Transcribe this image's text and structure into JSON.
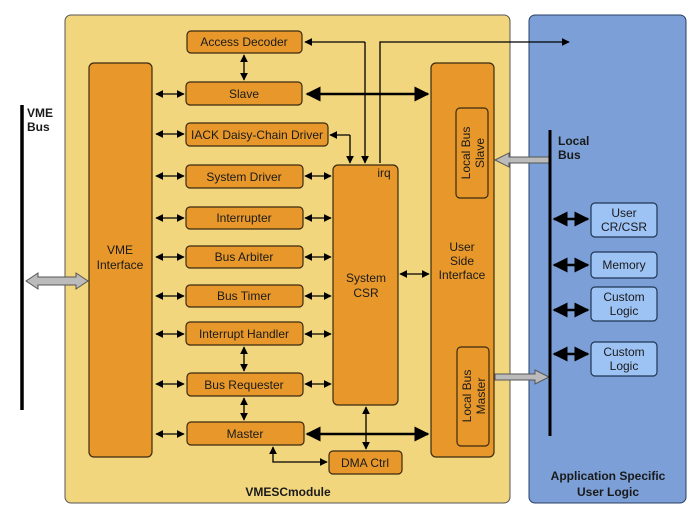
{
  "colors": {
    "module": "#f2d67e",
    "block": "#e8982a",
    "app": "#7b9fd6",
    "user_block": "#9dc3f5"
  },
  "vme_bus": [
    "VME",
    "Bus"
  ],
  "module_label": "VMESCmodule",
  "vme_interface": [
    "VME",
    "Interface"
  ],
  "blocks": {
    "access_decoder": "Access Decoder",
    "slave": "Slave",
    "iack": "IACK Daisy-Chain Driver",
    "system_driver": "System Driver",
    "interrupter": "Interrupter",
    "bus_arbiter": "Bus Arbiter",
    "bus_timer": "Bus Timer",
    "interrupt_handler": "Interrupt Handler",
    "bus_requester": "Bus Requester",
    "master": "Master",
    "dma_ctrl": "DMA Ctrl"
  },
  "system_csr": [
    "System",
    "CSR"
  ],
  "irq": "irq",
  "user_side": [
    "User",
    "Side",
    "Interface"
  ],
  "local_bus_slave": [
    "Local Bus",
    "Slave"
  ],
  "local_bus_master": [
    "Local Bus",
    "Master"
  ],
  "local_bus": [
    "Local",
    "Bus"
  ],
  "user_blocks": {
    "user_csr": [
      "User",
      "CR/CSR"
    ],
    "memory": "Memory",
    "custom1": [
      "Custom",
      "Logic"
    ],
    "custom2": [
      "Custom",
      "Logic"
    ]
  },
  "app_label": [
    "Application Specific",
    "User Logic"
  ]
}
